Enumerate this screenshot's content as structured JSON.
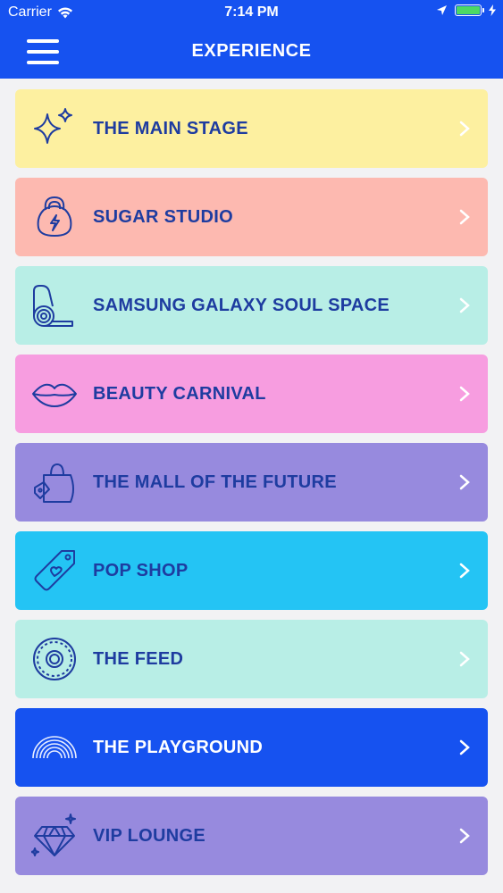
{
  "status_bar": {
    "carrier": "Carrier",
    "time": "7:14 PM",
    "battery_level": 1.0
  },
  "header": {
    "title": "EXPERIENCE"
  },
  "items": [
    {
      "label": "THE MAIN STAGE",
      "icon": "sparkle-icon",
      "bg": "#fdf0a0",
      "fg": "#1e3ca0",
      "chev": "#ffffff"
    },
    {
      "label": "SUGAR STUDIO",
      "icon": "kettlebell-icon",
      "bg": "#fdb9b0",
      "fg": "#1e3ca0",
      "chev": "#ffffff"
    },
    {
      "label": "SAMSUNG GALAXY SOUL SPACE",
      "icon": "yoga-mat-icon",
      "bg": "#b8eee6",
      "fg": "#1e3ca0",
      "chev": "#ffffff"
    },
    {
      "label": "BEAUTY CARNIVAL",
      "icon": "lips-icon",
      "bg": "#f79de0",
      "fg": "#1e3ca0",
      "chev": "#ffffff"
    },
    {
      "label": "THE MALL OF THE FUTURE",
      "icon": "shopping-bag-icon",
      "bg": "#978ade",
      "fg": "#1e3ca0",
      "chev": "#ffffff"
    },
    {
      "label": "POP SHOP",
      "icon": "price-tag-icon",
      "bg": "#24c4f4",
      "fg": "#1e3ca0",
      "chev": "#ffffff"
    },
    {
      "label": "THE FEED",
      "icon": "donut-icon",
      "bg": "#b8eee6",
      "fg": "#1e3ca0",
      "chev": "#ffffff"
    },
    {
      "label": "THE PLAYGROUND",
      "icon": "rainbow-icon",
      "bg": "#1652f0",
      "fg": "#ffffff",
      "chev": "#ffffff"
    },
    {
      "label": "VIP LOUNGE",
      "icon": "diamond-icon",
      "bg": "#978ade",
      "fg": "#1e3ca0",
      "chev": "#ffffff"
    }
  ]
}
